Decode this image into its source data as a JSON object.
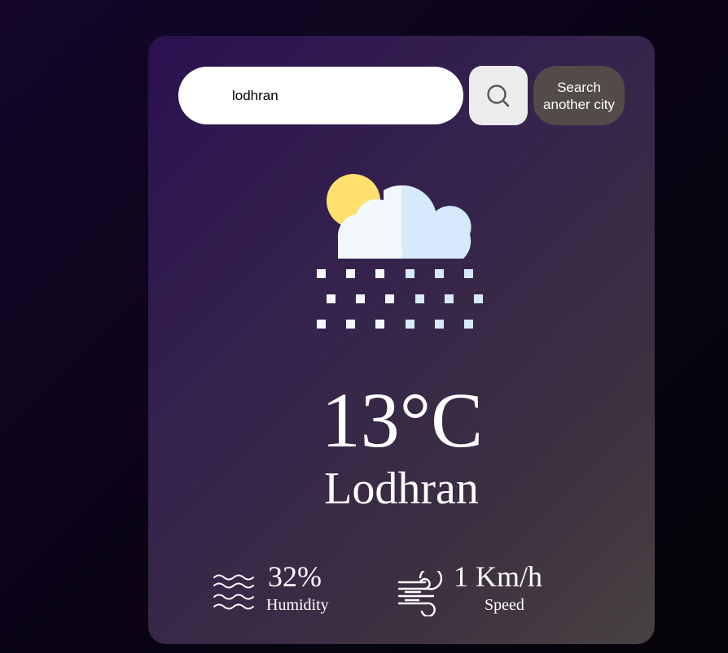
{
  "search": {
    "value": "lodhran",
    "placeholder": "",
    "search_icon": "search-icon",
    "another_city_label": "Search another city"
  },
  "weather": {
    "icon": "snow-cloud-sun-icon",
    "temperature": "13°C",
    "city": "Lodhran"
  },
  "humidity": {
    "icon": "humidity-waves-icon",
    "value": "32%",
    "label": "Humidity"
  },
  "wind": {
    "icon": "wind-icon",
    "value": "1 Km/h",
    "label": "Speed"
  },
  "colors": {
    "card_gradient_start": "#2b1150",
    "card_gradient_end": "#484242",
    "background": "#0b0418",
    "search_button_bg": "#ececec",
    "another_city_button_bg": "#524b49",
    "text": "#ffffff"
  }
}
